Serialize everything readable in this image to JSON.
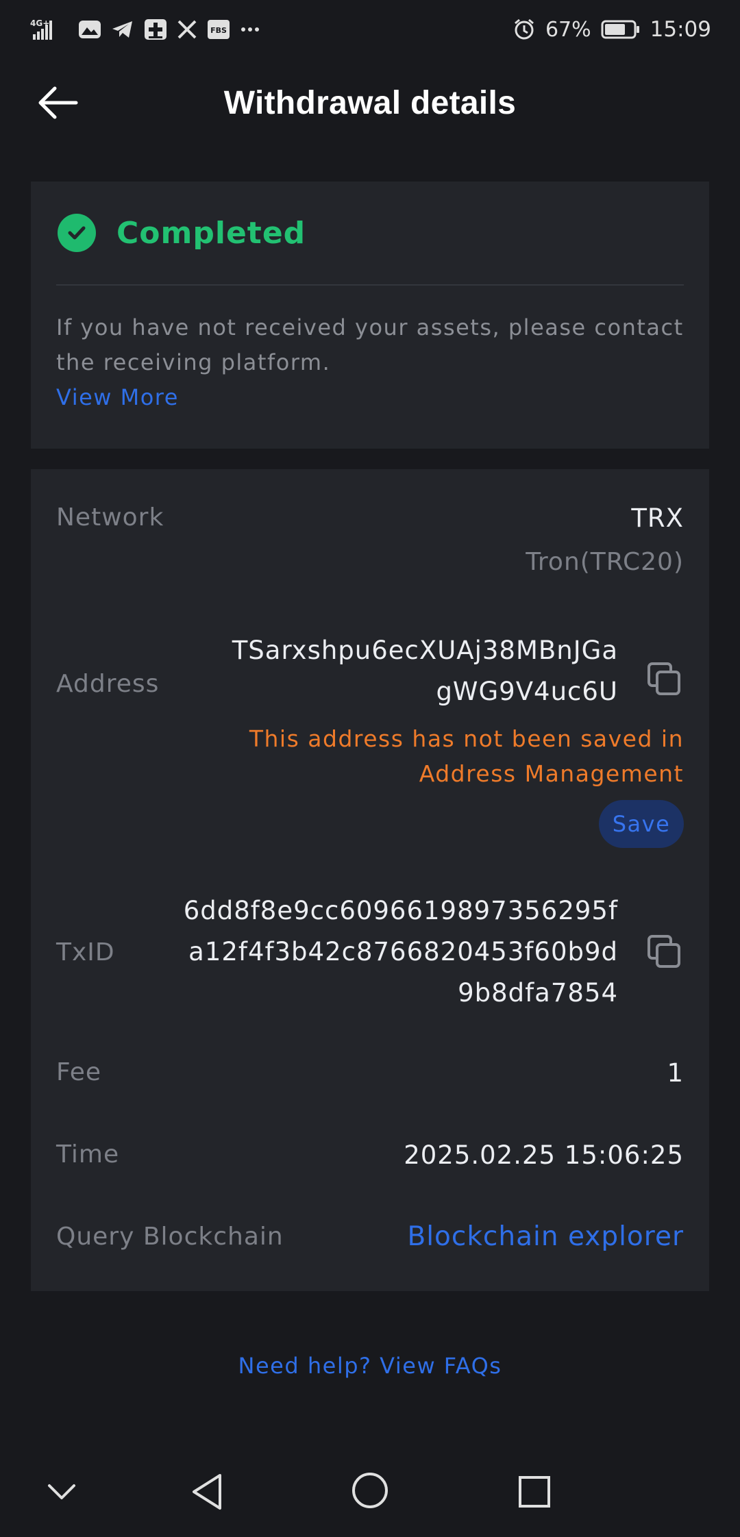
{
  "status_bar": {
    "network_label": "4G+",
    "battery_percent": "67%",
    "time": "15:09",
    "notification_icons": [
      "signal-icon",
      "photos-icon",
      "telegram-icon",
      "medical-plus-icon",
      "x-icon",
      "fbs-icon",
      "more-dots-icon"
    ]
  },
  "header": {
    "title": "Withdrawal details"
  },
  "status_card": {
    "status": "Completed",
    "notice": "If you have not received your assets, please contact the receiving platform.",
    "view_more": "View More"
  },
  "details": {
    "network": {
      "label": "Network",
      "value": "TRX",
      "subvalue": "Tron(TRC20)"
    },
    "address": {
      "label": "Address",
      "line1": "TSarxshpu6ecXUAj38MBnJGa",
      "line2": "gWG9V4uc6U",
      "warning_line1": "This address has not been saved in",
      "warning_line2": "Address Management",
      "save": "Save"
    },
    "txid": {
      "label": "TxID",
      "line1": "6dd8f8e9cc6096619897356295f",
      "line2": "a12f4f3b42c8766820453f60b9d",
      "line3": "9b8dfa7854"
    },
    "fee": {
      "label": "Fee",
      "value": "1"
    },
    "time": {
      "label": "Time",
      "value": "2025.02.25 15:06:25"
    },
    "query": {
      "label": "Query Blockchain",
      "value": "Blockchain explorer"
    }
  },
  "help": {
    "text": "Need help? View FAQs"
  },
  "colors": {
    "background": "#18191d",
    "card": "#23252a",
    "success": "#22c172",
    "link": "#2f6fe8",
    "warning": "#ef7b2a"
  }
}
